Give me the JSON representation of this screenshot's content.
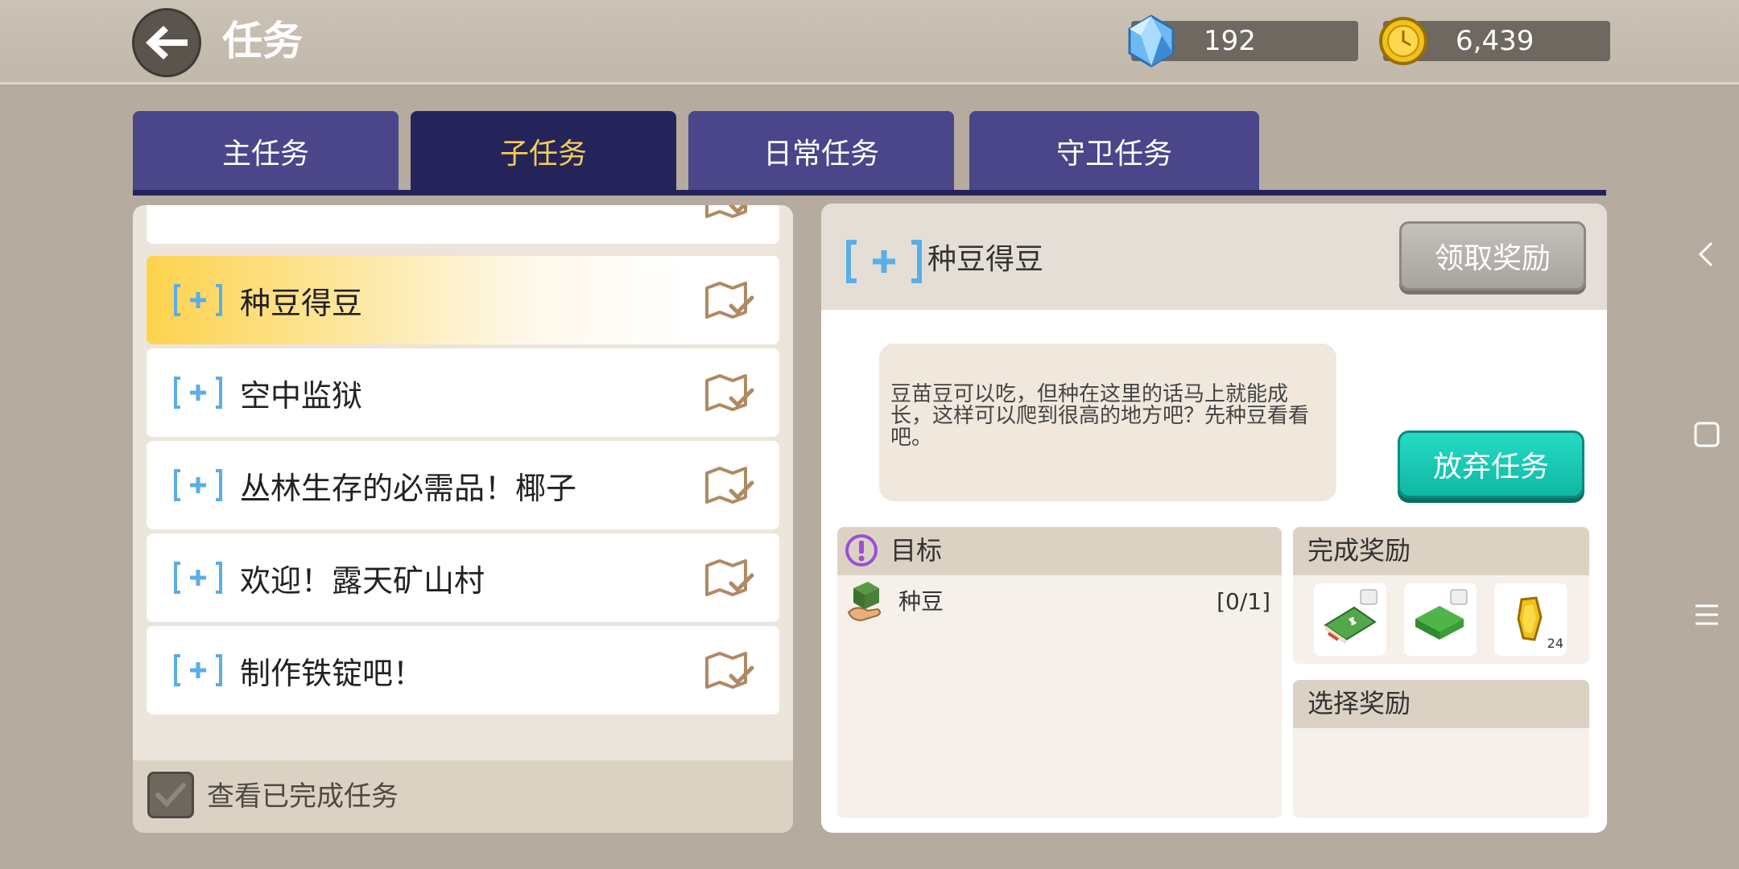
{
  "header": {
    "title": "任务",
    "gems": "192",
    "coins": "6,439"
  },
  "tabs": [
    {
      "label": "主任务"
    },
    {
      "label": "子任务",
      "active": true
    },
    {
      "label": "日常任务"
    },
    {
      "label": "守卫任务"
    }
  ],
  "quest_list": [
    {
      "label": "种豆得豆",
      "selected": true
    },
    {
      "label": "空中监狱"
    },
    {
      "label": "丛林生存的必需品！椰子"
    },
    {
      "label": "欢迎！露天矿山村"
    },
    {
      "label": "制作铁锭吧！"
    }
  ],
  "footer": {
    "show_completed_label": "查看已完成任务"
  },
  "detail": {
    "title": "种豆得豆",
    "claim_button": "领取奖励",
    "description": "豆苗豆可以吃，但种在这里的话马上就能成长，这样可以爬到很高的地方吧？先种豆看看吧。",
    "abandon_button": "放弃任务",
    "goal_header": "目标",
    "goal": {
      "name": "种豆",
      "progress": "[0/1]"
    },
    "reward_header": "完成奖励",
    "select_header": "选择奖励",
    "rewards": [
      {
        "icon": "seed-book-icon"
      },
      {
        "icon": "grass-block-icon"
      },
      {
        "icon": "gold-coin-icon",
        "count": "24"
      }
    ]
  },
  "colors": {
    "tab": "#4b4689",
    "tab_active": "#25245a",
    "tab_active_text": "#f4cd55",
    "abandon": "#1bc9b4",
    "bracket": "#5aaee8"
  }
}
